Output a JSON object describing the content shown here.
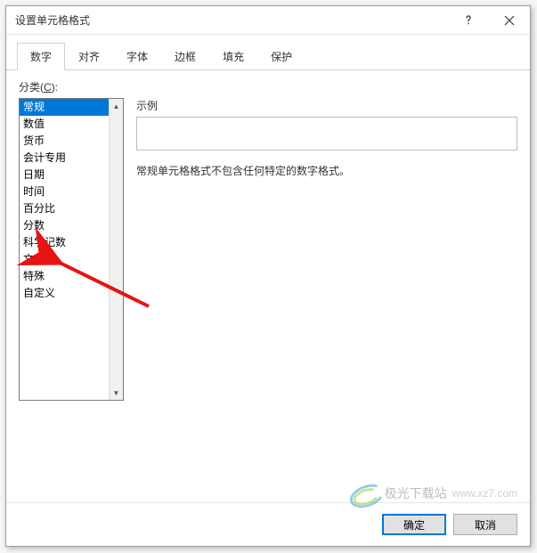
{
  "titlebar": {
    "title": "设置单元格格式"
  },
  "tabs": {
    "items": [
      {
        "label": "数字",
        "active": true
      },
      {
        "label": "对齐",
        "active": false
      },
      {
        "label": "字体",
        "active": false
      },
      {
        "label": "边框",
        "active": false
      },
      {
        "label": "填充",
        "active": false
      },
      {
        "label": "保护",
        "active": false
      }
    ]
  },
  "category": {
    "label_prefix": "分类(",
    "label_key": "C",
    "label_suffix": "):",
    "items": [
      "常规",
      "数值",
      "货币",
      "会计专用",
      "日期",
      "时间",
      "百分比",
      "分数",
      "科学记数",
      "文本",
      "特殊",
      "自定义"
    ],
    "selected_index": 0
  },
  "sample": {
    "label": "示例",
    "value": ""
  },
  "description": "常规单元格格式不包含任何特定的数字格式。",
  "footer": {
    "ok": "确定",
    "cancel": "取消"
  },
  "watermark": {
    "brand": "极光下载站",
    "url": "www.xz7.com"
  },
  "annotation": {
    "arrow_color": "#e81313"
  }
}
